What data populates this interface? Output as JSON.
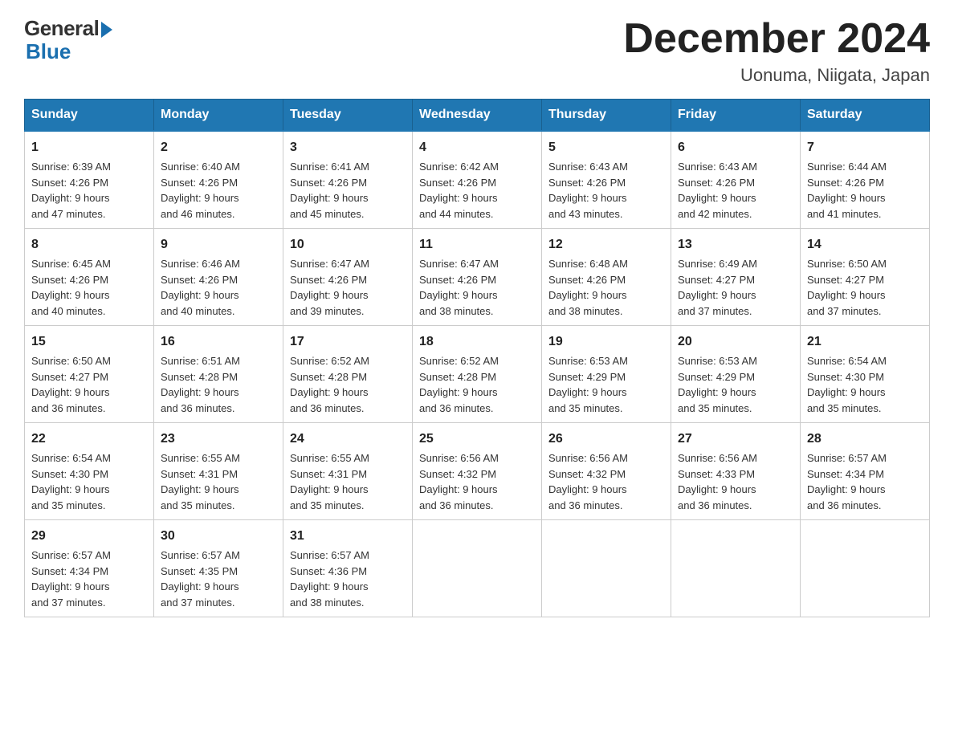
{
  "header": {
    "logo_general": "General",
    "logo_blue": "Blue",
    "month_title": "December 2024",
    "location": "Uonuma, Niigata, Japan"
  },
  "weekdays": [
    "Sunday",
    "Monday",
    "Tuesday",
    "Wednesday",
    "Thursday",
    "Friday",
    "Saturday"
  ],
  "weeks": [
    [
      {
        "day": "1",
        "sunrise": "6:39 AM",
        "sunset": "4:26 PM",
        "daylight": "9 hours and 47 minutes."
      },
      {
        "day": "2",
        "sunrise": "6:40 AM",
        "sunset": "4:26 PM",
        "daylight": "9 hours and 46 minutes."
      },
      {
        "day": "3",
        "sunrise": "6:41 AM",
        "sunset": "4:26 PM",
        "daylight": "9 hours and 45 minutes."
      },
      {
        "day": "4",
        "sunrise": "6:42 AM",
        "sunset": "4:26 PM",
        "daylight": "9 hours and 44 minutes."
      },
      {
        "day": "5",
        "sunrise": "6:43 AM",
        "sunset": "4:26 PM",
        "daylight": "9 hours and 43 minutes."
      },
      {
        "day": "6",
        "sunrise": "6:43 AM",
        "sunset": "4:26 PM",
        "daylight": "9 hours and 42 minutes."
      },
      {
        "day": "7",
        "sunrise": "6:44 AM",
        "sunset": "4:26 PM",
        "daylight": "9 hours and 41 minutes."
      }
    ],
    [
      {
        "day": "8",
        "sunrise": "6:45 AM",
        "sunset": "4:26 PM",
        "daylight": "9 hours and 40 minutes."
      },
      {
        "day": "9",
        "sunrise": "6:46 AM",
        "sunset": "4:26 PM",
        "daylight": "9 hours and 40 minutes."
      },
      {
        "day": "10",
        "sunrise": "6:47 AM",
        "sunset": "4:26 PM",
        "daylight": "9 hours and 39 minutes."
      },
      {
        "day": "11",
        "sunrise": "6:47 AM",
        "sunset": "4:26 PM",
        "daylight": "9 hours and 38 minutes."
      },
      {
        "day": "12",
        "sunrise": "6:48 AM",
        "sunset": "4:26 PM",
        "daylight": "9 hours and 38 minutes."
      },
      {
        "day": "13",
        "sunrise": "6:49 AM",
        "sunset": "4:27 PM",
        "daylight": "9 hours and 37 minutes."
      },
      {
        "day": "14",
        "sunrise": "6:50 AM",
        "sunset": "4:27 PM",
        "daylight": "9 hours and 37 minutes."
      }
    ],
    [
      {
        "day": "15",
        "sunrise": "6:50 AM",
        "sunset": "4:27 PM",
        "daylight": "9 hours and 36 minutes."
      },
      {
        "day": "16",
        "sunrise": "6:51 AM",
        "sunset": "4:28 PM",
        "daylight": "9 hours and 36 minutes."
      },
      {
        "day": "17",
        "sunrise": "6:52 AM",
        "sunset": "4:28 PM",
        "daylight": "9 hours and 36 minutes."
      },
      {
        "day": "18",
        "sunrise": "6:52 AM",
        "sunset": "4:28 PM",
        "daylight": "9 hours and 36 minutes."
      },
      {
        "day": "19",
        "sunrise": "6:53 AM",
        "sunset": "4:29 PM",
        "daylight": "9 hours and 35 minutes."
      },
      {
        "day": "20",
        "sunrise": "6:53 AM",
        "sunset": "4:29 PM",
        "daylight": "9 hours and 35 minutes."
      },
      {
        "day": "21",
        "sunrise": "6:54 AM",
        "sunset": "4:30 PM",
        "daylight": "9 hours and 35 minutes."
      }
    ],
    [
      {
        "day": "22",
        "sunrise": "6:54 AM",
        "sunset": "4:30 PM",
        "daylight": "9 hours and 35 minutes."
      },
      {
        "day": "23",
        "sunrise": "6:55 AM",
        "sunset": "4:31 PM",
        "daylight": "9 hours and 35 minutes."
      },
      {
        "day": "24",
        "sunrise": "6:55 AM",
        "sunset": "4:31 PM",
        "daylight": "9 hours and 35 minutes."
      },
      {
        "day": "25",
        "sunrise": "6:56 AM",
        "sunset": "4:32 PM",
        "daylight": "9 hours and 36 minutes."
      },
      {
        "day": "26",
        "sunrise": "6:56 AM",
        "sunset": "4:32 PM",
        "daylight": "9 hours and 36 minutes."
      },
      {
        "day": "27",
        "sunrise": "6:56 AM",
        "sunset": "4:33 PM",
        "daylight": "9 hours and 36 minutes."
      },
      {
        "day": "28",
        "sunrise": "6:57 AM",
        "sunset": "4:34 PM",
        "daylight": "9 hours and 36 minutes."
      }
    ],
    [
      {
        "day": "29",
        "sunrise": "6:57 AM",
        "sunset": "4:34 PM",
        "daylight": "9 hours and 37 minutes."
      },
      {
        "day": "30",
        "sunrise": "6:57 AM",
        "sunset": "4:35 PM",
        "daylight": "9 hours and 37 minutes."
      },
      {
        "day": "31",
        "sunrise": "6:57 AM",
        "sunset": "4:36 PM",
        "daylight": "9 hours and 38 minutes."
      },
      null,
      null,
      null,
      null
    ]
  ],
  "labels": {
    "sunrise": "Sunrise:",
    "sunset": "Sunset:",
    "daylight": "Daylight:"
  }
}
